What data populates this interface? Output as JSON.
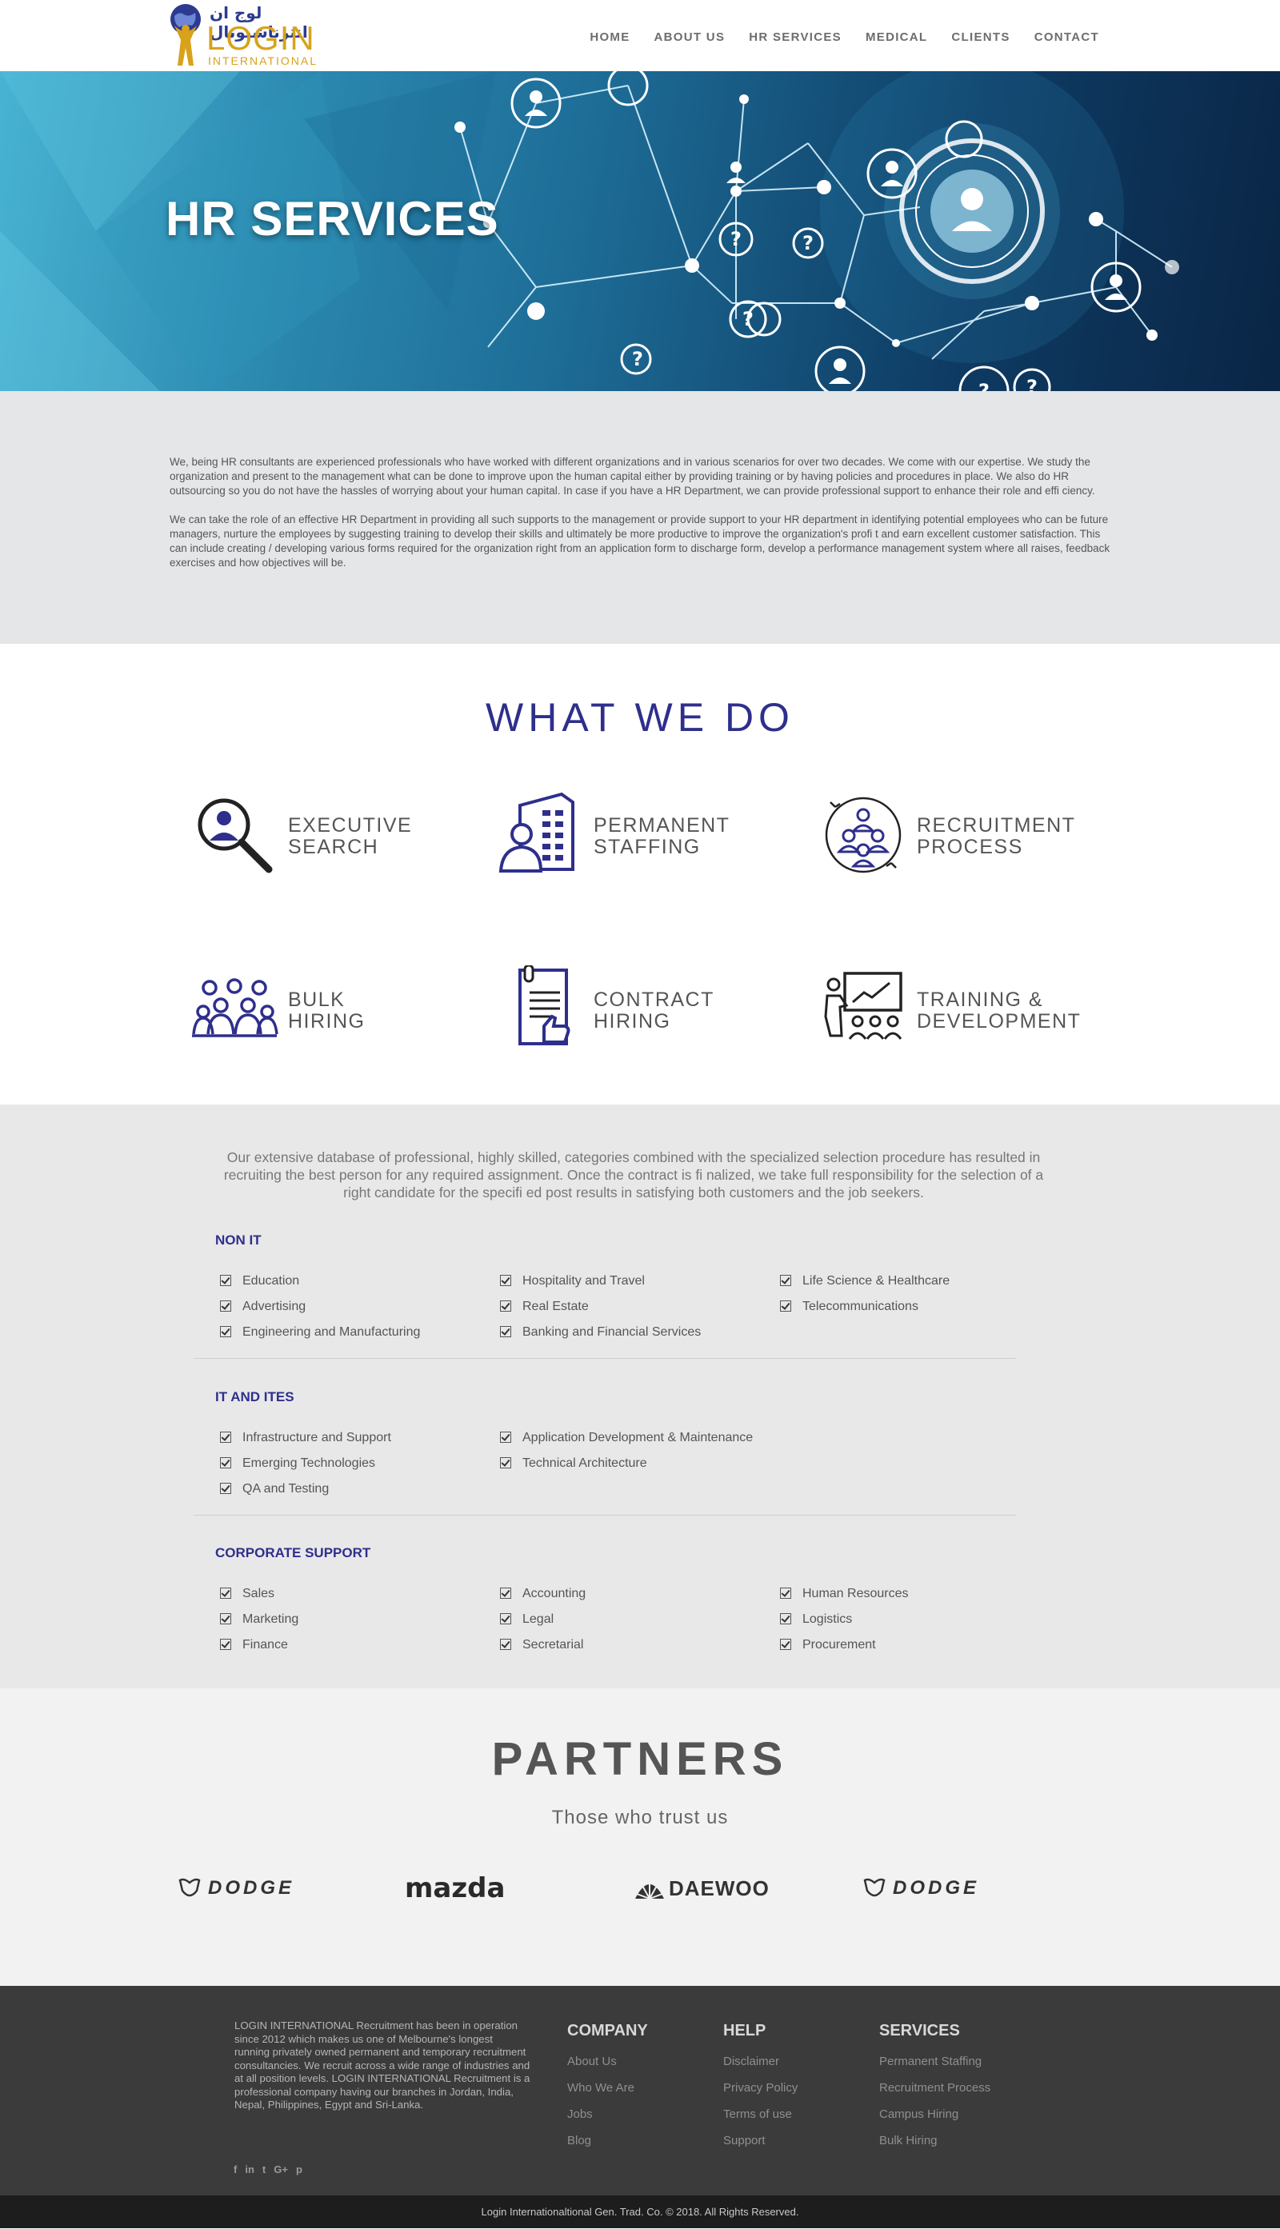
{
  "header": {
    "logo": {
      "arabic": "لوج ان انترناشيونال",
      "main": "LOGIN",
      "sub": "INTERNATIONAL"
    },
    "nav": [
      "HOME",
      "ABOUT US",
      "HR SERVICES",
      "MEDICAL",
      "CLIENTS",
      "CONTACT"
    ]
  },
  "hero": {
    "title_bold": "HR",
    "title_rest": " SERVICES"
  },
  "intro": {
    "p1": "We, being HR consultants are experienced professionals who have worked with different organizations and in various scenarios for over two decades. We come with our expertise. We study the organization and present to the management what can be done to improve upon the human capital either by providing training or by having policies and procedures in place. We also do HR outsourcing so you do not have the hassles of worrying about your human capital. In case if you have a HR Department, we can provide professional support to enhance their role and effi ciency.",
    "p2": "We can take the role of an effective HR Department in providing all such supports to the management or provide support to your HR department in identifying potential employees who can be future managers, nurture the employees by suggesting training to develop their skills and ultimately be more productive to improve the organization's profi t and earn excellent customer satisfaction. This can include creating / developing various forms required for the organization right from an application form to discharge form, develop a performance management system where all raises, feedback exercises and how objectives will be."
  },
  "what_we_do": {
    "title": "WHAT WE DO",
    "services": [
      {
        "line1": "EXECUTIVE",
        "line2": "SEARCH",
        "icon": "magnifier-person-icon"
      },
      {
        "line1": "PERMANENT",
        "line2": "STAFFING",
        "icon": "building-person-icon"
      },
      {
        "line1": "RECRUITMENT",
        "line2": "PROCESS",
        "icon": "team-cycle-icon"
      },
      {
        "line1": "BULK",
        "line2": "HIRING",
        "icon": "group-icon"
      },
      {
        "line1": "CONTRACT",
        "line2": "HIRING",
        "icon": "contract-thumb-icon"
      },
      {
        "line1": "TRAINING &",
        "line2": "DEVELOPMENT",
        "icon": "presentation-icon"
      }
    ],
    "accent": "#2e2f8c"
  },
  "categories": {
    "lead": "Our extensive database of professional, highly skilled, categories combined with the specialized selection procedure has resulted in recruiting the best person for any required assignment. Once the contract is fi nalized, we take full responsibility for the selection of a right candidate for the specifi ed post results in satisfying both customers and the job seekers.",
    "groups": [
      {
        "title": "NON IT",
        "cols": [
          [
            "Education",
            "Advertising",
            "Engineering and Manufacturing"
          ],
          [
            "Hospitality and Travel",
            "Real Estate",
            "Banking and Financial Services"
          ],
          [
            "Life Science & Healthcare",
            "Telecommunications"
          ]
        ]
      },
      {
        "title": "IT AND ITES",
        "cols": [
          [
            "Infrastructure and Support",
            "Emerging Technologies",
            "QA and Testing"
          ],
          [
            "Application Development & Maintenance",
            "Technical Architecture"
          ]
        ]
      },
      {
        "title": "CORPORATE SUPPORT",
        "cols": [
          [
            "Sales",
            "Marketing",
            "Finance"
          ],
          [
            "Accounting",
            "Legal",
            "Secretarial"
          ],
          [
            "Human Resources",
            "Logistics",
            "Procurement"
          ]
        ]
      }
    ]
  },
  "partners": {
    "title": "PARTNERS",
    "subtitle": "Those who trust us",
    "logos": [
      "DODGE",
      "mazda",
      "DAEWOO",
      "DODGE"
    ]
  },
  "footer": {
    "about": "LOGIN INTERNATIONAL Recruitment has been in operation since 2012 which makes us one of Melbourne's longest running privately owned permanent and temporary recruitment consultancies. We recruit across a wide range of industries and at all position levels. LOGIN INTERNATIONAL Recruitment is a professional company having our branches in Jordan, India, Nepal, Philippines, Egypt and Sri-Lanka.",
    "social": [
      "f",
      "in",
      "t",
      "G+",
      "p"
    ],
    "columns": [
      {
        "title": "COMPANY",
        "links": [
          "About Us",
          "Who We Are",
          "Jobs",
          "Blog"
        ]
      },
      {
        "title": "HELP",
        "links": [
          "Disclaimer",
          "Privacy Policy",
          "Terms of use",
          "Support"
        ]
      },
      {
        "title": "SERVICES",
        "links": [
          "Permanent Staffing",
          "Recruitment Process",
          "Campus Hiring",
          "Bulk Hiring"
        ]
      }
    ],
    "copyright": "Login Internationaltional Gen. Trad. Co. © 2018. All Rights Reserved."
  }
}
